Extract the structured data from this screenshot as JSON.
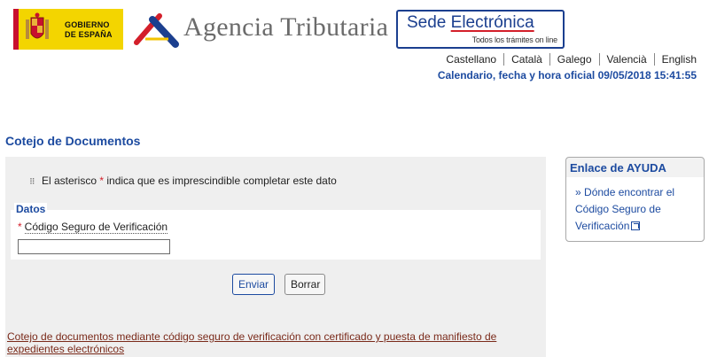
{
  "header": {
    "gobierno_line1": "GOBIERNO",
    "gobierno_line2": "DE ESPAÑA",
    "agency_title": "Agencia Tributaria",
    "sede_prefix": "Sede ",
    "sede_highlight": "Electrónica",
    "sede_tagline": "Todos los trámites on line",
    "languages": [
      "Castellano",
      "Català",
      "Galego",
      "Valencià",
      "English"
    ],
    "clock": "Calendario, fecha y hora oficial 09/05/2018 15:41:55"
  },
  "page": {
    "title": "Cotejo de Documentos"
  },
  "form": {
    "note_before": "El asterisco ",
    "note_star": "*",
    "note_after": " indica que es imprescindible completar este dato",
    "legend": "Datos",
    "field_star": "*",
    "field_label": "Código Seguro de Verificación",
    "field_value": "",
    "submit_label": "Enviar",
    "reset_label": "Borrar"
  },
  "footer": {
    "link_text": "Cotejo de documentos mediante código seguro de verificación con certificado y puesta de manifiesto de expedientes electrónicos"
  },
  "help": {
    "title": "Enlace de AYUDA",
    "link_prefix": "»",
    "link_text": "Dónde encontrar el Código Seguro de Verificación"
  },
  "colors": {
    "brand_blue": "#1d4ba0",
    "required_red": "#d31f2a",
    "gobierno_yellow": "#f3d500"
  }
}
